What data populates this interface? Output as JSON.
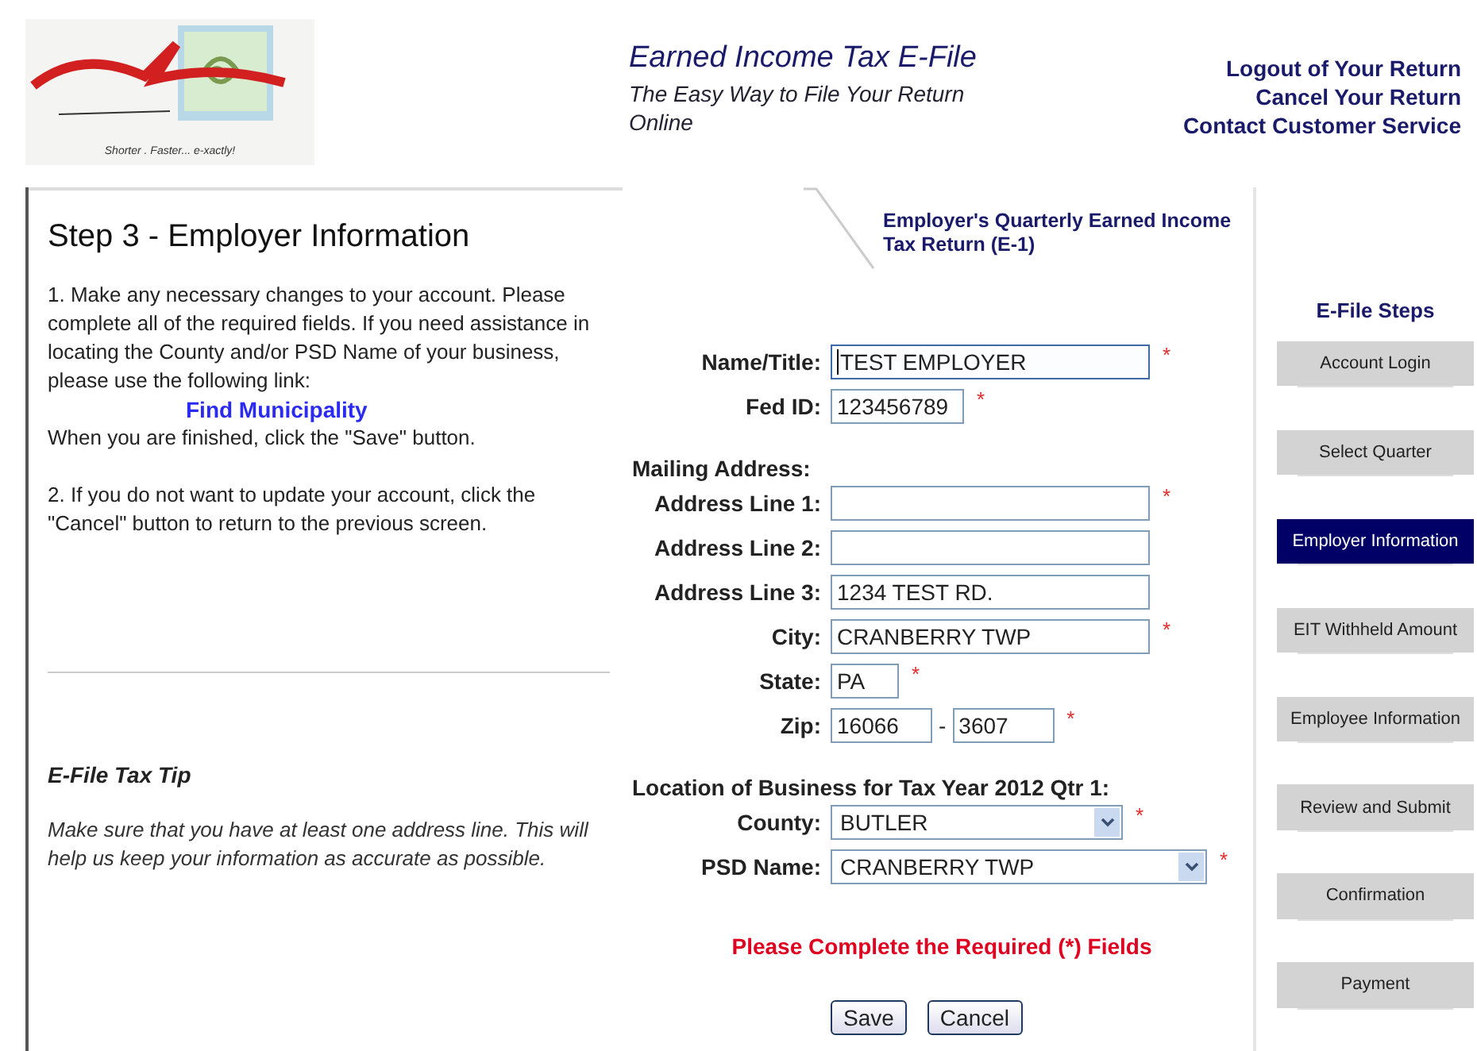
{
  "header": {
    "logo_tagline": "Shorter . Faster... e-xactly!",
    "title": "Earned Income Tax E-File",
    "subtitle": "The Easy Way to File Your Return Online",
    "links": [
      "Logout of Your Return",
      "Cancel Your Return",
      "Contact Customer Service"
    ]
  },
  "tab": {
    "label": "Employer's Quarterly Earned Income Tax Return (E-1)"
  },
  "instructions": {
    "heading": "Step 3 - Employer Information",
    "paragraph_1": "1. Make any necessary changes to your account. Please complete all of the required fields. If you need assistance in locating the County and/or PSD Name of your business, please use the following link:",
    "link": "Find Municipality",
    "paragraph_1_end": "When you are finished, click the \"Save\" button.",
    "paragraph_2": "2. If you do not want to update your account, click the \"Cancel\" button to return to the previous screen."
  },
  "tip": {
    "heading": "E-File Tax Tip",
    "text": "Make sure that you have at least one address line. This will help us keep your information as accurate as possible."
  },
  "form": {
    "sections": [
      {
        "fields": [
          {
            "label": "Name/Title:",
            "kind": "text",
            "value": "TEST EMPLOYER",
            "required": true,
            "focused": true
          },
          {
            "label": "Fed ID:",
            "kind": "number",
            "value": "123456789",
            "required": true,
            "focused": false
          }
        ]
      },
      {
        "heading": "Mailing Address:",
        "fields": [
          {
            "label": "Address Line 1:",
            "kind": "text",
            "required": true,
            "focused": false
          },
          {
            "label": "Address Line 2:",
            "kind": "text",
            "required": false,
            "focused": false
          },
          {
            "label": "Address Line 3:",
            "kind": "text",
            "value": "1234 TEST RD.",
            "required": false,
            "focused": false
          },
          {
            "label": "City:",
            "kind": "text",
            "value": "CRANBERRY TWP",
            "required": true,
            "focused": false
          },
          {
            "label": "State:",
            "kind": "code",
            "value": "PA",
            "required": true,
            "focused": false
          },
          {
            "label": "Zip:",
            "kind": "zip",
            "value": "16066",
            "separator": "-",
            "extension": "3607",
            "required": true,
            "focused": false
          }
        ]
      },
      {
        "heading": "Location of Business for Tax Year 2012 Qtr 1:",
        "fields": [
          {
            "label": "County:",
            "kind": "select",
            "value": "BUTLER",
            "required": true,
            "focused": false
          },
          {
            "label": "PSD Name:",
            "kind": "select",
            "value": "CRANBERRY TWP",
            "required": true,
            "focused": false
          }
        ]
      }
    ],
    "required_marker": "*",
    "warning": "Please Complete the Required (*) Fields",
    "buttons": [
      "Save",
      "Cancel"
    ]
  },
  "steps": {
    "heading": "E-File Steps",
    "items": [
      {
        "label": "Account Login",
        "selected": false
      },
      {
        "label": "Select Quarter",
        "selected": false
      },
      {
        "label": "Employer Information",
        "selected": true
      },
      {
        "label": "EIT Withheld Amount",
        "selected": false
      },
      {
        "label": "Employee Information",
        "selected": false
      },
      {
        "label": "Review and Submit",
        "selected": false
      },
      {
        "label": "Confirmation",
        "selected": false
      },
      {
        "label": "Payment",
        "selected": false
      }
    ]
  }
}
